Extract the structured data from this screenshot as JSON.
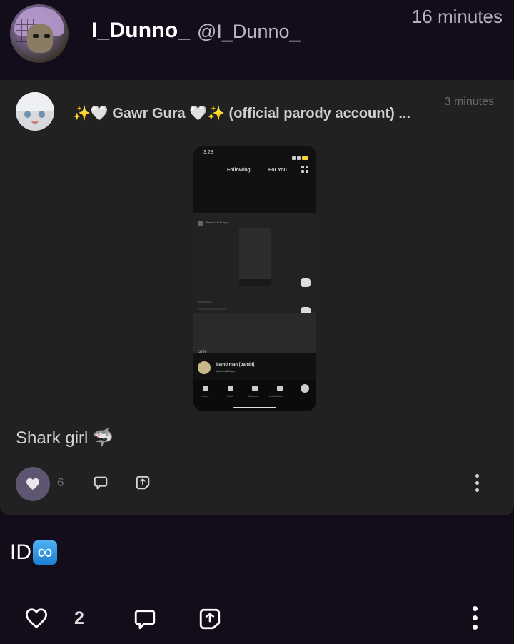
{
  "post": {
    "username": "I_Dunno_",
    "handle": "@I_Dunno_",
    "time": "16 minutes",
    "text": "ID",
    "like_count": "2",
    "icons": [
      "heart-outline-icon",
      "comment-icon",
      "share-icon",
      "more-icon",
      "infinity-emoji"
    ]
  },
  "quoted": {
    "name": "✨🤍 Gawr Gura 🤍✨ (official parody account) ...",
    "time": "3 minutes",
    "caption": "Shark girl",
    "caption_emoji": "🦈",
    "like_count": "6",
    "icons": [
      "heart-filled-icon",
      "comment-icon",
      "share-icon",
      "more-icon"
    ],
    "accent": "#5e5570"
  },
  "phone_screenshot": {
    "status_time": "3:28",
    "tab_following": "Following",
    "tab_foryou": "For You",
    "feed_username": "Reset Cat Ø hype",
    "caption_small": "cutie",
    "commenter": "bamb man [bambi]",
    "commenter_handle": "@bambiØhype",
    "nav": [
      "Home",
      "Chat",
      "Discover",
      "Notification"
    ]
  },
  "colors": {
    "background": "#130d1b",
    "card": "#212121",
    "accent": "#5e5570"
  }
}
